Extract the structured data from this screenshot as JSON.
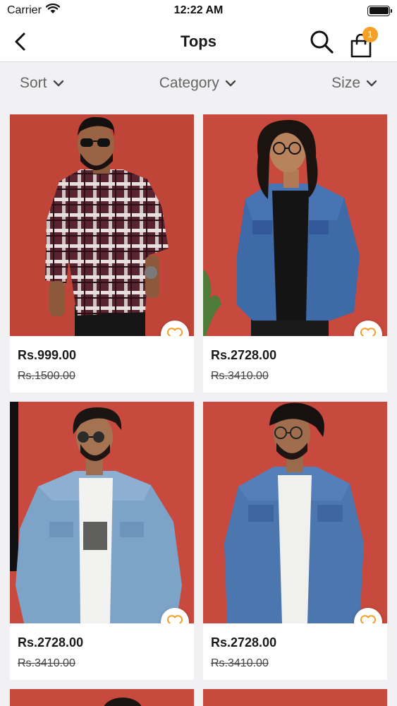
{
  "status_bar": {
    "carrier": "Carrier",
    "time": "12:22 AM"
  },
  "nav": {
    "title": "Tops",
    "cart_count": "1"
  },
  "filters": {
    "sort": "Sort",
    "category": "Category",
    "size": "Size"
  },
  "products": [
    {
      "price": "Rs.999.00",
      "old_price": "Rs.1500.00",
      "image": "man in red plaid flannel shirt with sunglasses"
    },
    {
      "price": "Rs.2728.00",
      "old_price": "Rs.3410.00",
      "image": "man with long curly hair in denim jacket"
    },
    {
      "price": "Rs.2728.00",
      "old_price": "Rs.3410.00",
      "image": "man in light wash denim jacket over graphic tee"
    },
    {
      "price": "Rs.2728.00",
      "old_price": "Rs.3410.00",
      "image": "man in blue denim jacket over white tee"
    }
  ],
  "colors": {
    "accent": "#f4a026",
    "wall": "#c4473c",
    "background": "#f1f1f4"
  }
}
